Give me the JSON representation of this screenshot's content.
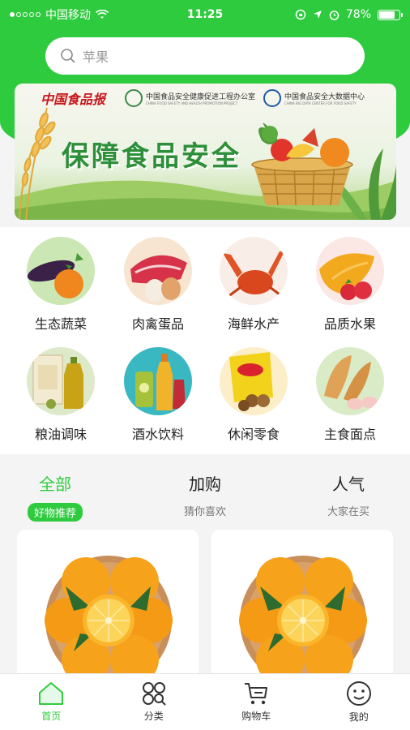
{
  "status_bar": {
    "carrier": "中国移动",
    "time": "11:25",
    "battery": "78%",
    "battery_level": 0.78
  },
  "search": {
    "placeholder": "苹果"
  },
  "banner": {
    "logo_left": "中国食品报",
    "org1_name": "中国食品安全健康促进工程办公室",
    "org1_sub": "CHINA FOOD SAFETY AND HEALTH PROMOTION PROJECT",
    "org2_name": "中国食品安全大数据中心",
    "org2_sub": "CHINA BIG DATA CENTER FOR FOOD SAFETY",
    "title": "保障食品安全"
  },
  "categories": [
    {
      "label": "生态蔬菜",
      "icon": "vegetables-icon"
    },
    {
      "label": "肉禽蛋品",
      "icon": "meat-eggs-icon"
    },
    {
      "label": "海鲜水产",
      "icon": "seafood-icon"
    },
    {
      "label": "品质水果",
      "icon": "fruit-icon"
    },
    {
      "label": "粮油调味",
      "icon": "grain-oil-icon"
    },
    {
      "label": "酒水饮料",
      "icon": "drinks-icon"
    },
    {
      "label": "休闲零食",
      "icon": "snacks-icon"
    },
    {
      "label": "主食面点",
      "icon": "bread-icon"
    }
  ],
  "tabs": [
    {
      "title": "全部",
      "sub": "好物推荐"
    },
    {
      "title": "加购",
      "sub": "猜你喜欢"
    },
    {
      "title": "人气",
      "sub": "大家在买"
    }
  ],
  "nav": [
    {
      "label": "首页",
      "icon": "home-icon"
    },
    {
      "label": "分类",
      "icon": "category-icon"
    },
    {
      "label": "购物车",
      "icon": "cart-icon"
    },
    {
      "label": "我的",
      "icon": "profile-icon"
    }
  ],
  "colors": {
    "accent": "#2fcb3e"
  }
}
